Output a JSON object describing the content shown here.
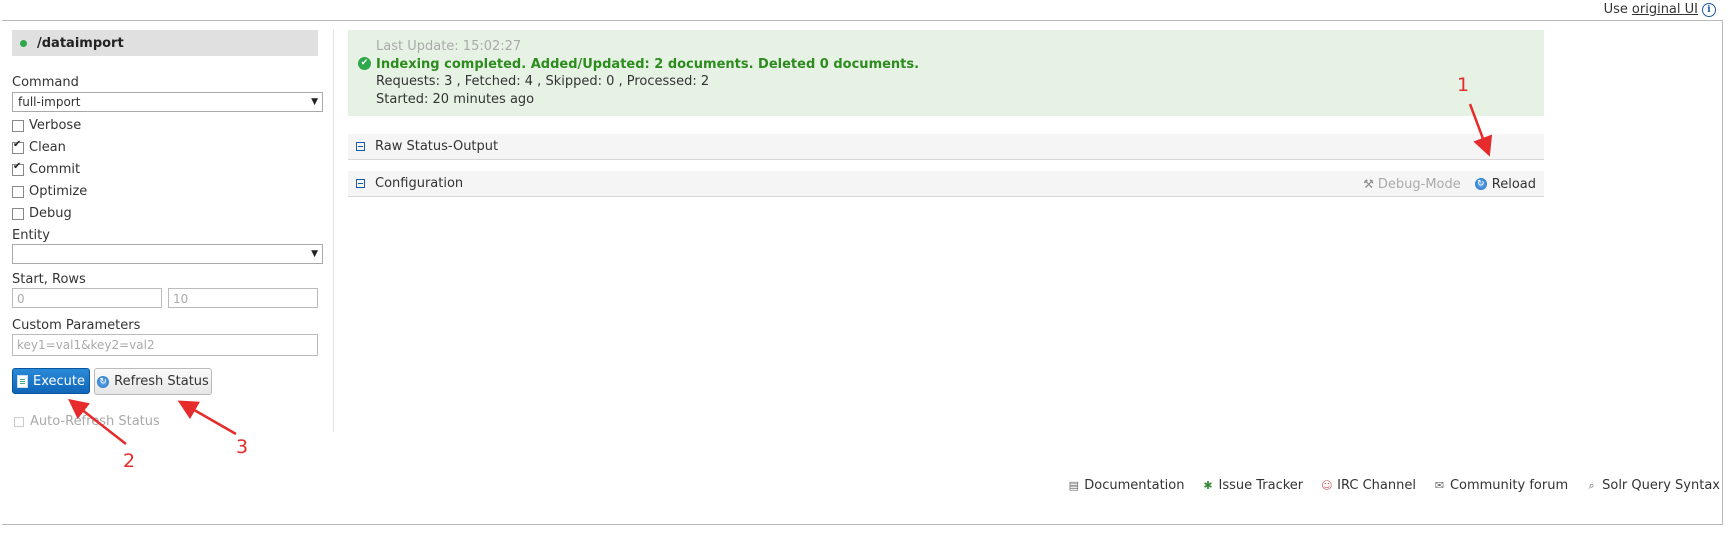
{
  "topbar": {
    "use_text": "Use",
    "link_text": "original UI",
    "icon": "info-icon"
  },
  "core": {
    "name": "/dataimport",
    "status_color": "#2ea84a"
  },
  "form": {
    "command_label": "Command",
    "command_value": "full-import",
    "checkboxes": [
      {
        "label": "Verbose",
        "checked": false
      },
      {
        "label": "Clean",
        "checked": true
      },
      {
        "label": "Commit",
        "checked": true
      },
      {
        "label": "Optimize",
        "checked": false
      },
      {
        "label": "Debug",
        "checked": false
      }
    ],
    "entity_label": "Entity",
    "entity_value": "",
    "start_rows_label": "Start, Rows",
    "start_placeholder": "0",
    "rows_placeholder": "10",
    "custom_params_label": "Custom Parameters",
    "custom_params_placeholder": "key1=val1&key2=val2",
    "execute_label": "Execute",
    "refresh_label": "Refresh Status",
    "auto_refresh_label": "Auto-Refresh Status"
  },
  "status": {
    "last_update": "Last Update: 15:02:27",
    "message": "Indexing completed. Added/Updated: 2 documents. Deleted 0 documents.",
    "counts": "Requests: 3 , Fetched: 4 , Skipped: 0 , Processed: 2",
    "started": "Started: 20 minutes ago",
    "bg_color": "#e6f3e4",
    "ok_color": "#2e8b1f"
  },
  "sections": {
    "raw_status": "Raw Status-Output",
    "configuration": "Configuration",
    "debug_mode": "Debug-Mode",
    "reload": "Reload"
  },
  "footer": [
    {
      "label": "Documentation",
      "icon": "document-icon"
    },
    {
      "label": "Issue Tracker",
      "icon": "bug-icon"
    },
    {
      "label": "IRC Channel",
      "icon": "people-icon"
    },
    {
      "label": "Community forum",
      "icon": "mail-icon"
    },
    {
      "label": "Solr Query Syntax",
      "icon": "query-icon"
    }
  ],
  "annotations": [
    "1",
    "2",
    "3"
  ],
  "accent_color": "#0f66b8",
  "annotation_color": "#e52b2b"
}
